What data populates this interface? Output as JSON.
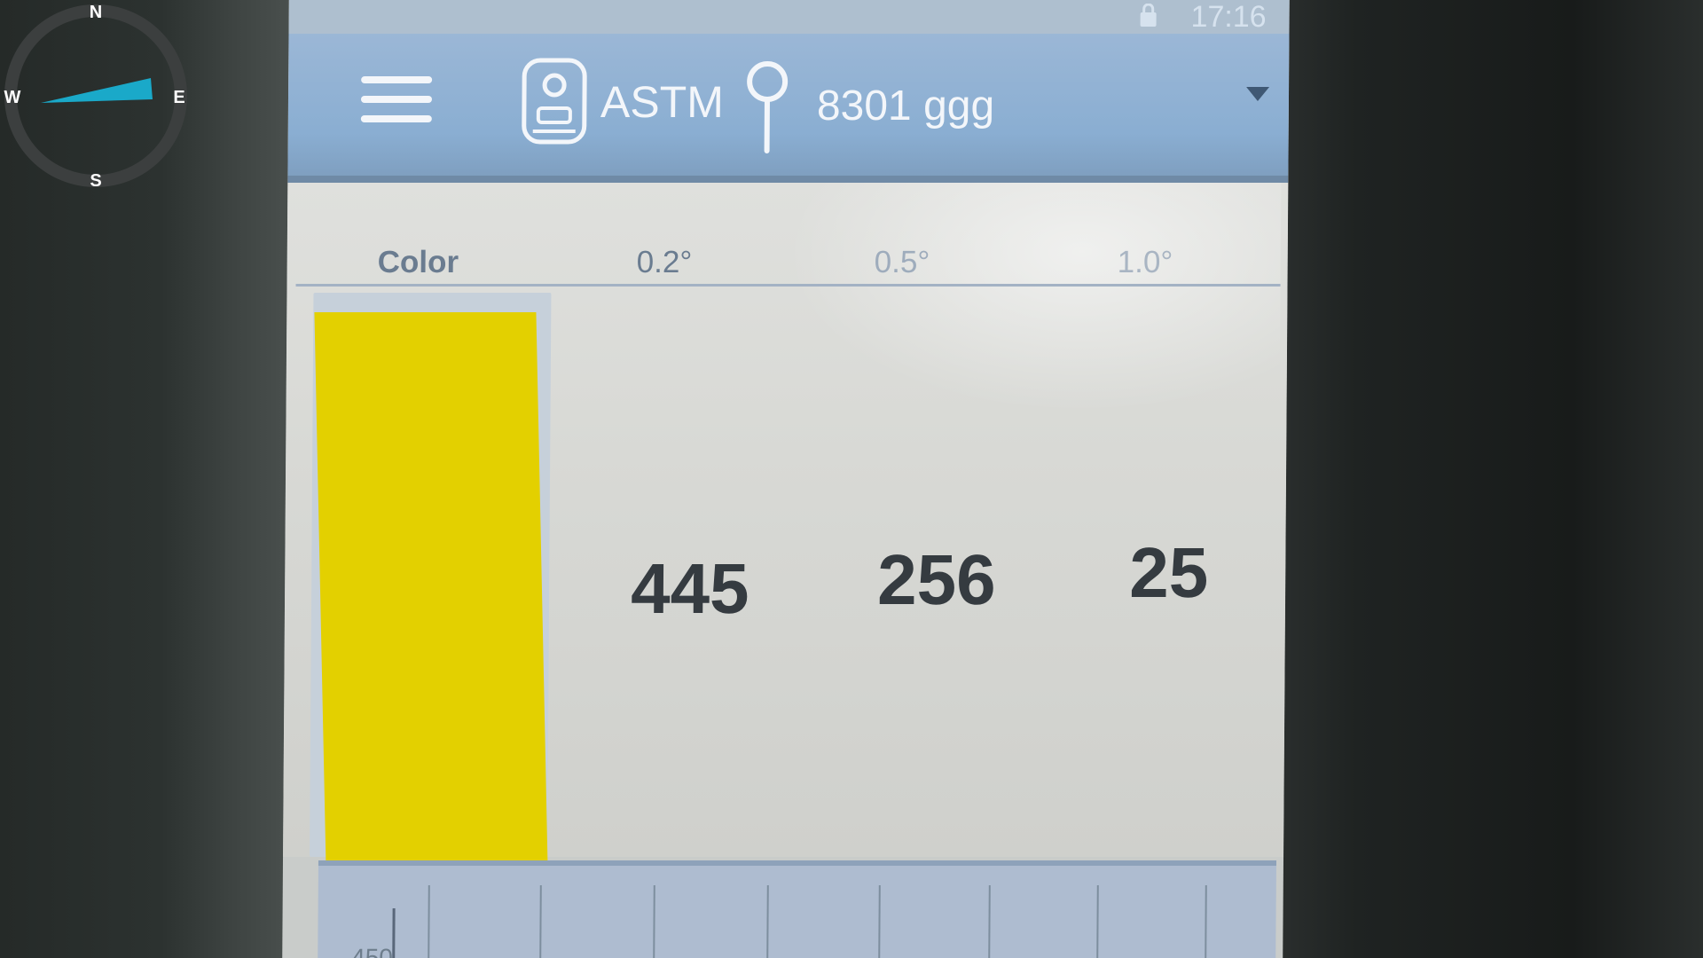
{
  "status_bar": {
    "time": "17:16"
  },
  "header": {
    "standard": "ASTM",
    "sample": "8301 ggg",
    "icons": [
      "menu-icon",
      "device-icon",
      "pin-icon",
      "dropdown-icon"
    ]
  },
  "table": {
    "columns": [
      "Color",
      "0.2°",
      "0.5°",
      "1.0°"
    ],
    "values": [
      "445",
      "256",
      "25"
    ],
    "swatch_color": "#e3d000"
  },
  "chart": {
    "y_tick": "450"
  },
  "compass": {
    "north": "N",
    "south": "S",
    "east": "E",
    "west": "W",
    "needle_color": "#1aa9c9"
  }
}
